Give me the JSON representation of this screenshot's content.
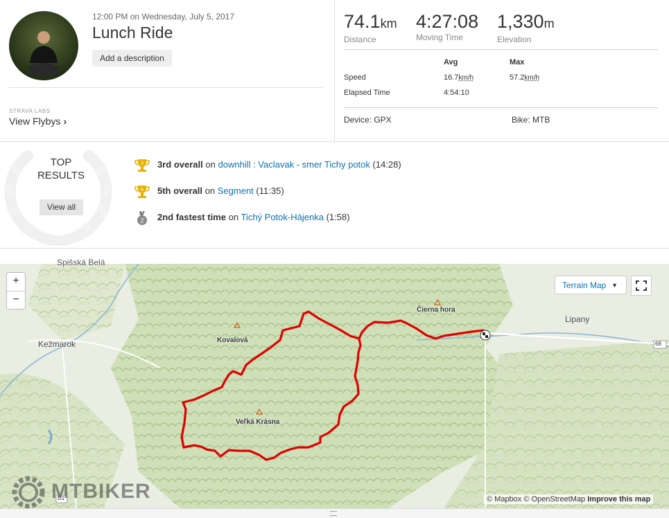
{
  "activity": {
    "datetime": "12:00 PM on Wednesday, July 5, 2017",
    "title": "Lunch Ride",
    "add_description": "Add a description"
  },
  "labs": {
    "label": "STRAVA LABS",
    "flybys": "View Flybys"
  },
  "stats": {
    "distance": {
      "value": "74.1",
      "unit": "km",
      "label": "Distance"
    },
    "moving_time": {
      "value": "4:27:08",
      "label": "Moving Time"
    },
    "elevation": {
      "value": "1,330",
      "unit": "m",
      "label": "Elevation"
    }
  },
  "details": {
    "col_avg": "Avg",
    "col_max": "Max",
    "speed_label": "Speed",
    "speed_avg": "16.7",
    "speed_max": "57.2",
    "speed_unit": "km/h",
    "elapsed_label": "Elapsed Time",
    "elapsed_value": "4:54:10",
    "device": "Device: GPX",
    "bike": "Bike: MTB"
  },
  "top_results": {
    "line1": "TOP",
    "line2": "RESULTS",
    "view_all": "View all"
  },
  "achievements": [
    {
      "rank": "3rd overall",
      "on": "on",
      "segment": "downhill : Vaclavak - smer Tichy potok",
      "time": "(14:28)",
      "badge": "3",
      "icon": "gold-trophy-icon",
      "color": "#e8b000"
    },
    {
      "rank": "5th overall",
      "on": "on",
      "segment": "Segment",
      "time": "(11:35)",
      "badge": "5",
      "icon": "gold-trophy-icon",
      "color": "#e8b000"
    },
    {
      "rank": "2nd fastest time",
      "on": "on",
      "segment": "Tichý Potok-Hájenka",
      "time": "(1:58)",
      "badge": "2",
      "icon": "silver-medal-icon",
      "color": "#8a8a8a"
    }
  ],
  "map": {
    "zoom_in": "+",
    "zoom_out": "−",
    "style_select": "Terrain Map",
    "labels": {
      "kezmarok": "Kežmarok",
      "kovalova": "Kovalová",
      "velka_krasna": "Veľká Krásna",
      "cierna_hora": "Čierna hora",
      "lipany": "Lipany",
      "road_68": "68",
      "road_d1": "D1",
      "top_cut": "Spišská Belá"
    },
    "attribution_mapbox": "© Mapbox",
    "attribution_osm": "© OpenStreetMap",
    "improve": "Improve this map",
    "watermark": "MTBIKER",
    "route_color": "#e00000",
    "accent": "#0a72b3"
  }
}
